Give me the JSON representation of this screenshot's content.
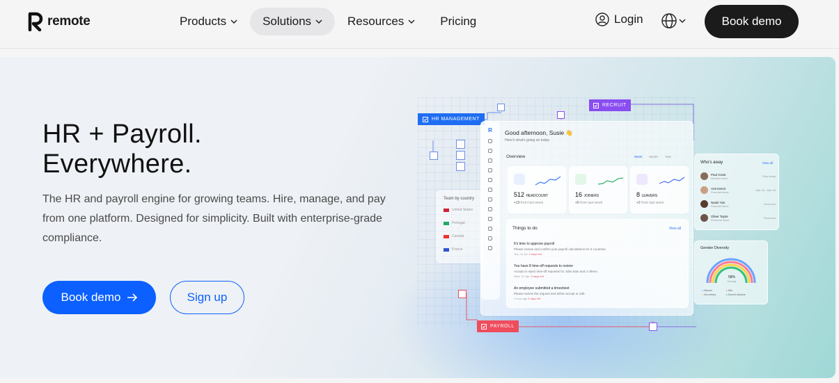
{
  "brand": {
    "name": "remote"
  },
  "nav": {
    "items": [
      {
        "label": "Products",
        "has_dropdown": true,
        "active": false
      },
      {
        "label": "Solutions",
        "has_dropdown": true,
        "active": true
      },
      {
        "label": "Resources",
        "has_dropdown": true,
        "active": false
      },
      {
        "label": "Pricing",
        "has_dropdown": false,
        "active": false
      }
    ],
    "login": "Login",
    "book_demo": "Book demo"
  },
  "hero": {
    "title_line1": "HR + Payroll.",
    "title_line2": "Everywhere.",
    "lead": "The HR and payroll engine for growing teams. Hire, manage, and pay from one platform. Designed for simplicity. Built with enterprise-grade compliance.",
    "primary_cta": "Book demo",
    "secondary_cta": "Sign up"
  },
  "illustration": {
    "tags": {
      "hr": "HR MANAGEMENT",
      "recruit": "RECRUIT",
      "payroll": "PAYROLL"
    },
    "greeting": "Good afternoon, Susie 👋",
    "greeting_sub": "Here's what's going on today.",
    "overview": "Overview",
    "overview_tabs": [
      "Week",
      "Month",
      "Year"
    ],
    "stats": [
      {
        "value": "512",
        "label": "HEADCOUNT",
        "delta": "+10",
        "delta_label": "from last week"
      },
      {
        "value": "16",
        "label": "JOINERS",
        "delta": "+5",
        "delta_label": "from last week"
      },
      {
        "value": "8",
        "label": "LEAVERS",
        "delta": "+2",
        "delta_label": "from last week"
      }
    ],
    "todo_title": "Things to do",
    "view_all": "View all",
    "todos": [
      {
        "title": "It's time to approve payroll",
        "desc": "Please review and confirm your payroll calculations for 3 countries.",
        "meta": "Tue, 11 Jul.",
        "due": "2 days left"
      },
      {
        "title": "You have 8 time-off requests to review",
        "desc": "Accept or reject time-off requests for Julia Sato and 4 others.",
        "meta": "Wed, 12 Jan.",
        "due": "5 days left"
      },
      {
        "title": "An employee submitted a timesheet",
        "desc": "Please review the request and either accept or edit.",
        "meta": "1 hour ago",
        "due": "3 days left"
      }
    ],
    "team_title": "Team by country",
    "countries": [
      "United States",
      "Portugal",
      "Canada",
      "France"
    ],
    "away_title": "Who's away",
    "away": [
      {
        "name": "Paul Grant",
        "reason": "Medical leave",
        "when": "Only today"
      },
      {
        "name": "Aria Demir",
        "reason": "Parental leave",
        "when": "Mar 16 - Mar 18"
      },
      {
        "name": "Naoki Yan",
        "reason": "Parental leave",
        "when": "Tomorrow"
      },
      {
        "name": "Oliver Taylor",
        "reason": "Personal leave",
        "when": "Tomorrow"
      }
    ],
    "diversity_title": "Gender Diversity",
    "diversity_value": "58%",
    "diversity_sub": "Average",
    "legend": [
      "Women",
      "Men",
      "Non-binary",
      "Doesn't disclose"
    ]
  }
}
